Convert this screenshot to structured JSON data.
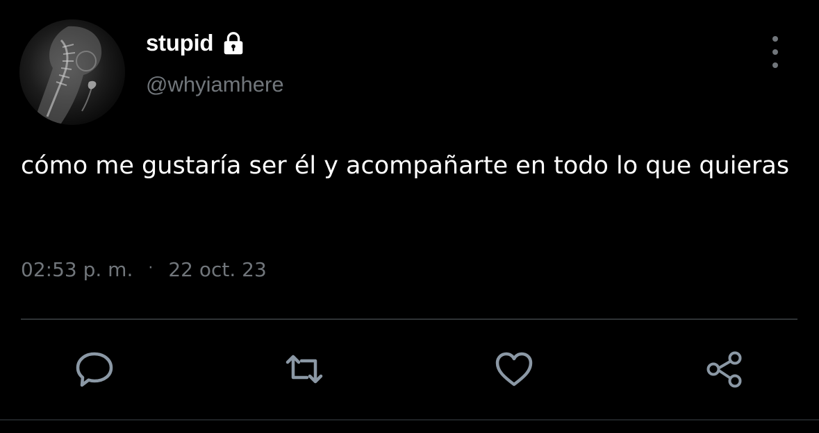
{
  "user": {
    "display_name": "stupid",
    "handle": "@whyiamhere",
    "protected_icon": "lock-icon",
    "avatar": "avatar-image"
  },
  "tweet": {
    "text": "cómo me gustaría ser él y acompañarte en todo lo que quieras",
    "time": "02:53 p. m.",
    "separator": "·",
    "date": "22 oct. 23"
  },
  "actions": {
    "reply_icon": "reply-icon",
    "retweet_icon": "retweet-icon",
    "like_icon": "heart-icon",
    "share_icon": "share-icon",
    "more_icon": "more-vertical-icon"
  },
  "colors": {
    "background": "#000000",
    "text": "#ffffff",
    "secondary": "#71767b",
    "divider": "#2f3336",
    "icon": "#8b98a5"
  }
}
